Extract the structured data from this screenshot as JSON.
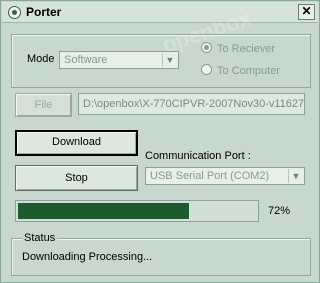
{
  "window": {
    "title": "Porter",
    "close_glyph": "✕"
  },
  "watermark": "openbox",
  "mode": {
    "label": "Mode",
    "selected": "Software",
    "radio_receiver": "To Reciever",
    "radio_computer": "To Computer",
    "receiver_selected": true
  },
  "file": {
    "button_label": "File",
    "path": "D:\\openbox\\X-770CIPVR-2007Nov30-v11627"
  },
  "actions": {
    "download_label": "Download",
    "stop_label": "Stop"
  },
  "comm": {
    "label": "Communication Port :",
    "selected": "USB Serial Port (COM2)"
  },
  "progress": {
    "value_percent": 72,
    "label": "72%"
  },
  "status": {
    "legend": "Status",
    "message": "Downloading Processing..."
  },
  "colors": {
    "progress_fill": "#1d5a2e",
    "background": "#c6d6cc"
  }
}
